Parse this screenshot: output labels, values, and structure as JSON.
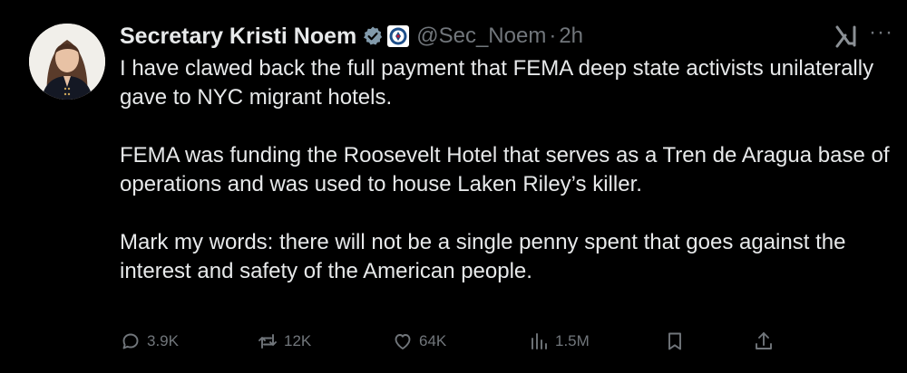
{
  "tweet": {
    "author": {
      "display_name": "Secretary Kristi Noem",
      "handle": "@Sec_Noem",
      "verified_color": "#829aab"
    },
    "separator": "·",
    "time": "2h",
    "more_label": "···",
    "paragraphs": [
      "I have clawed back the full payment that FEMA deep state activists unilaterally gave to NYC migrant hotels.",
      "FEMA was funding the Roosevelt Hotel that serves as a Tren de Aragua base of operations and was used to house Laken Riley’s killer.",
      "Mark my words: there will not be a single penny spent that goes against the interest and safety of the American people."
    ],
    "metrics": {
      "replies": "3.9K",
      "reposts": "12K",
      "likes": "64K",
      "views": "1.5M"
    }
  },
  "icons": {
    "reply": "speech-bubble-icon",
    "repost": "repost-arrows-icon",
    "like": "heart-icon",
    "views": "bar-chart-icon",
    "bookmark": "bookmark-icon",
    "share": "share-upload-icon",
    "grok": "grok-icon",
    "verified": "verified-badge-icon",
    "affiliation": "dhs-seal-icon"
  }
}
